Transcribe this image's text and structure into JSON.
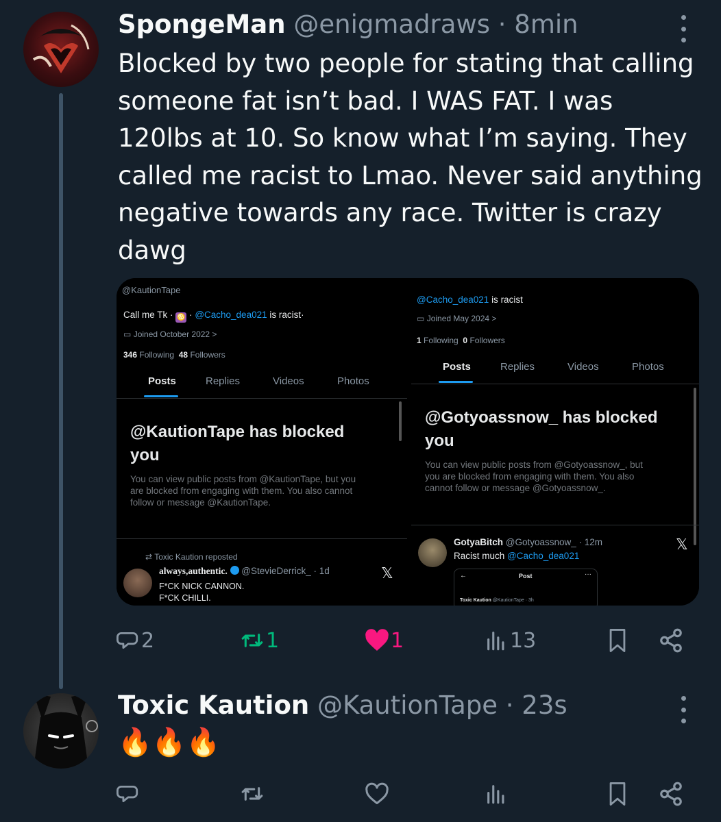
{
  "tweet": {
    "name": "SpongeMan",
    "handle": "@enigmadraws",
    "separator": "·",
    "time": "8min",
    "text_lines": [
      "Blocked by two people for stating that calling",
      "someone fat isn’t bad. I WAS FAT. I was",
      "120lbs at 10. So know what I’m saying. They",
      "called me racist to Lmao. Never said anything",
      "negative towards any race. Twitter is crazy",
      "dawg"
    ],
    "actions": {
      "replies": "2",
      "reposts": "1",
      "likes": "1",
      "views": "13"
    }
  },
  "screenshot_left": {
    "handle_top": "@KautionTape",
    "bio_prefix": "Call me Tk ·",
    "bio_sep": "·",
    "bio_mention": "@Cacho_dea021",
    "bio_suffix": "is racist·",
    "joined": "Joined October 2022 >",
    "following_count": "346",
    "following_label": "Following",
    "followers_count": "48",
    "followers_label": "Followers",
    "tabs": [
      "Posts",
      "Replies",
      "Videos",
      "Photos"
    ],
    "blocked_title_line1": "@KautionTape has blocked",
    "blocked_title_line2": "you",
    "blocked_desc_lines": [
      "You can view public posts from @KautionTape, but you",
      "are blocked from engaging with them. You also cannot",
      "follow or message @KautionTape."
    ],
    "repost_label": "Toxic Kaution reposted",
    "post_name": "always,authentic.",
    "post_handle": "@StevieDerrick_ · 1d",
    "post_lines": [
      "F*CK NICK CANNON.",
      "F*CK CHILLI."
    ]
  },
  "screenshot_right": {
    "bio_mention": "@Cacho_dea021",
    "bio_suffix": "is racist",
    "joined": "Joined May 2024 >",
    "following_count": "1",
    "following_label": "Following",
    "followers_count": "0",
    "followers_label": "Followers",
    "tabs": [
      "Posts",
      "Replies",
      "Videos",
      "Photos"
    ],
    "blocked_title_line1": "@Gotyoassnow_ has blocked",
    "blocked_title_line2": "you",
    "blocked_desc_lines": [
      "You can view public posts from @Gotyoassnow_, but",
      "you are blocked from engaging with them. You also",
      "cannot follow or message @Gotyoassnow_."
    ],
    "post_name": "GotyaBitch",
    "post_handle": "@Gotyoassnow_ · 12m",
    "post_text_prefix": "Racist much",
    "post_mention": "@Cacho_dea021",
    "embed_title": "Post",
    "embed_author": "Toxic Kaution",
    "embed_handle": "@KautionTape · 3h"
  },
  "reply": {
    "name": "Toxic Kaution",
    "handle": "@KautionTape",
    "separator": "·",
    "time": "23s",
    "text": "🔥🔥🔥"
  },
  "colors": {
    "background": "#15202b",
    "accent": "#1d9bf0",
    "repost": "#00ba7c",
    "like": "#f91880",
    "muted": "#8b98a5"
  }
}
